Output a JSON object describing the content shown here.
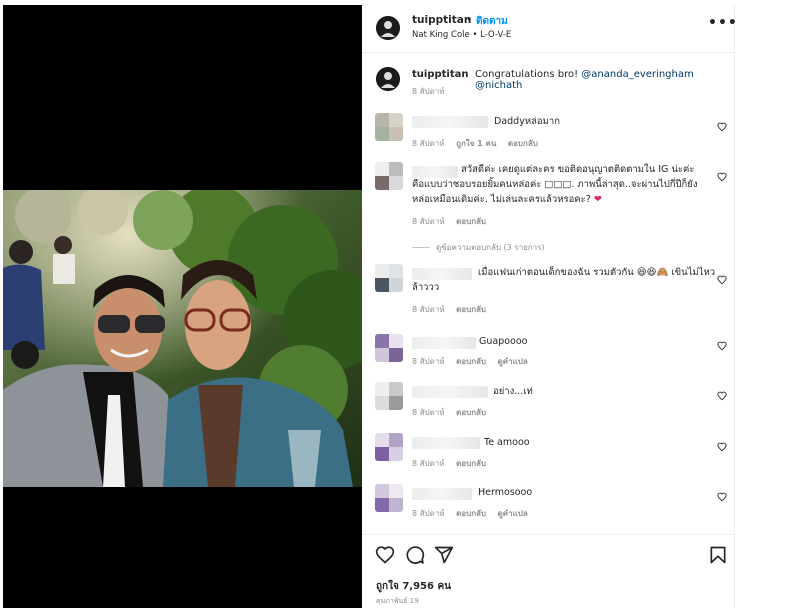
{
  "header": {
    "username": "tuipptitan",
    "separator": "•",
    "follow_label": "ติดตาม",
    "subtitle": "Nat King Cole • L-O-V-E",
    "more_label": "•••"
  },
  "caption": {
    "username": "tuipptitan",
    "text": "Congratulations bro!",
    "mention1": "@ananda_everingham",
    "mention2": "@nichath",
    "time": "8 สัปดาห์"
  },
  "comments": [
    {
      "text": "Daddyหล่อมาก",
      "time": "8 สัปดาห์",
      "likes": "ถูกใจ 1 คน",
      "reply": "ตอบกลับ"
    },
    {
      "line1": "สวัสดีค่ะ เคยดูแต่ละคร ขอติดอนุญาตติดตามใน IG น่ะค่ะ",
      "line2": "คือแบบว่าชอบรอยยิ้มคนหล่อค่ะ □□□. ภาพนี้ล่าสุด..จะผ่านไปกี่ปีก็ยัง",
      "line3": "หล่อเหมือนเดิมค่ะ. ไม่เล่นละครแล้วหรอคะ?",
      "time": "8 สัปดาห์",
      "reply": "ตอบกลับ"
    },
    {
      "line1": "เมื่อแฟนเก่าตอนเด็กของฉัน รวมตัวกัน",
      "line1b": "เขินไม่ไหว",
      "line2": "ล้าววว",
      "time": "8 สัปดาห์",
      "reply": "ตอบกลับ"
    },
    {
      "text": "Guapoooo",
      "time": "8 สัปดาห์",
      "reply": "ตอบกลับ",
      "translate": "ดูคำแปล"
    },
    {
      "text": "อย่าง...เท่",
      "time": "8 สัปดาห์",
      "reply": "ตอบกลับ"
    },
    {
      "text": "Te amooo",
      "time": "8 สัปดาห์",
      "reply": "ตอบกลับ"
    },
    {
      "text": "Hermosooo",
      "time": "8 สัปดาห์",
      "reply": "ตอบกลับ",
      "translate": "ดูคำแปล"
    }
  ],
  "view_replies": "ดูข้อความตอบกลับ (3 รายการ)",
  "footer": {
    "likes": "ถูกใจ 7,956 คน",
    "date": "คุมภาพันธ์ 19"
  },
  "icons": {
    "heart": "heart-icon",
    "comment": "comment-icon",
    "share": "share-icon",
    "save": "bookmark-icon",
    "more": "more-icon"
  },
  "colors": {
    "link": "#0095f6",
    "mention": "#00376b",
    "muted": "#8e8e8e",
    "red_heart": "#e0245e"
  }
}
